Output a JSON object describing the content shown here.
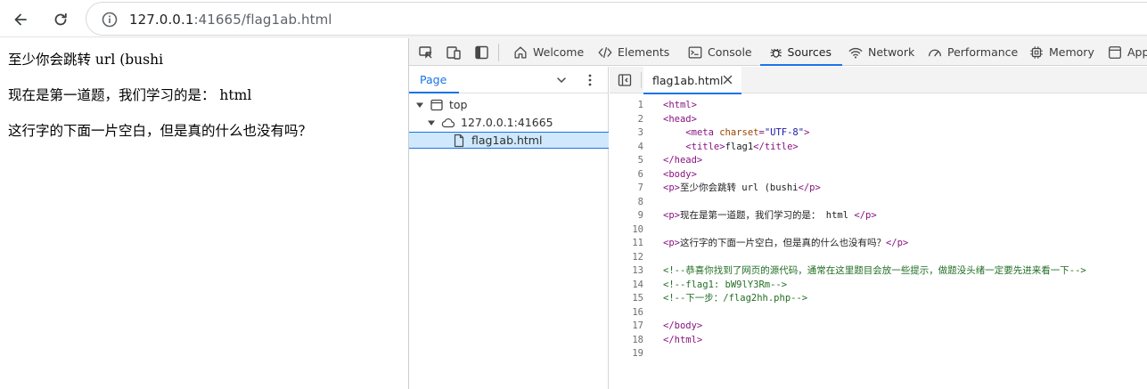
{
  "browser": {
    "url_host": "127.0.0.1",
    "url_path": ":41665/flag1ab.html"
  },
  "page": {
    "lines": [
      "至少你会跳转 url (bushi",
      "现在是第一道题，我们学习的是： html",
      "这行字的下面一片空白，但是真的什么也没有吗？"
    ]
  },
  "devtools": {
    "tabs": [
      {
        "label": "Welcome",
        "icon": "home-icon"
      },
      {
        "label": "Elements",
        "icon": "code-brackets-icon"
      },
      {
        "label": "Console",
        "icon": "console-icon"
      },
      {
        "label": "Sources",
        "icon": "bug-icon",
        "active": true
      },
      {
        "label": "Network",
        "icon": "wifi-icon"
      },
      {
        "label": "Performance",
        "icon": "gauge-icon"
      },
      {
        "label": "Memory",
        "icon": "chip-icon"
      },
      {
        "label": "App",
        "icon": "application-icon"
      }
    ],
    "navigator": {
      "tab_label": "Page",
      "tree": {
        "top": "top",
        "origin": "127.0.0.1:41665",
        "file": "flag1ab.html"
      }
    },
    "editor": {
      "file_tab": "flag1ab.html",
      "lines": [
        {
          "n": "1",
          "html": "<span class='tag'>&lt;html&gt;</span>"
        },
        {
          "n": "2",
          "html": "<span class='tag'>&lt;head&gt;</span>"
        },
        {
          "n": "3",
          "html": "    <span class='tag'>&lt;meta </span><span class='attr'>charset</span><span class='tag'>=</span><span class='val'>\"UTF-8\"</span><span class='tag'>&gt;</span>"
        },
        {
          "n": "4",
          "html": "    <span class='tag'>&lt;title&gt;</span>flag1<span class='tag'>&lt;/title&gt;</span>"
        },
        {
          "n": "5",
          "html": "<span class='tag'>&lt;/head&gt;</span>"
        },
        {
          "n": "6",
          "html": "<span class='tag'>&lt;body&gt;</span>"
        },
        {
          "n": "7",
          "html": "<span class='tag'>&lt;p&gt;</span>至少你会跳转 url (bushi<span class='tag'>&lt;/p&gt;</span>"
        },
        {
          "n": "8",
          "html": ""
        },
        {
          "n": "9",
          "html": "<span class='tag'>&lt;p&gt;</span>现在是第一道题，我们学习的是： html <span class='tag'>&lt;/p&gt;</span>"
        },
        {
          "n": "10",
          "html": ""
        },
        {
          "n": "11",
          "html": "<span class='tag'>&lt;p&gt;</span>这行字的下面一片空白，但是真的什么也没有吗？<span class='tag'>&lt;/p&gt;</span>"
        },
        {
          "n": "12",
          "html": ""
        },
        {
          "n": "13",
          "html": "<span class='comment'>&lt;!--恭喜你找到了网页的源代码，通常在这里题目会放一些提示，做题没头绪一定要先进来看一下--&gt;</span>"
        },
        {
          "n": "14",
          "html": "<span class='comment'>&lt;!--flag1: bW9lY3Rm--&gt;</span>"
        },
        {
          "n": "15",
          "html": "<span class='comment'>&lt;!--下一步：/flag2hh.php--&gt;</span>"
        },
        {
          "n": "16",
          "html": ""
        },
        {
          "n": "17",
          "html": "<span class='tag'>&lt;/body&gt;</span>"
        },
        {
          "n": "18",
          "html": "<span class='tag'>&lt;/html&gt;</span>"
        },
        {
          "n": "19",
          "html": ""
        }
      ]
    }
  }
}
